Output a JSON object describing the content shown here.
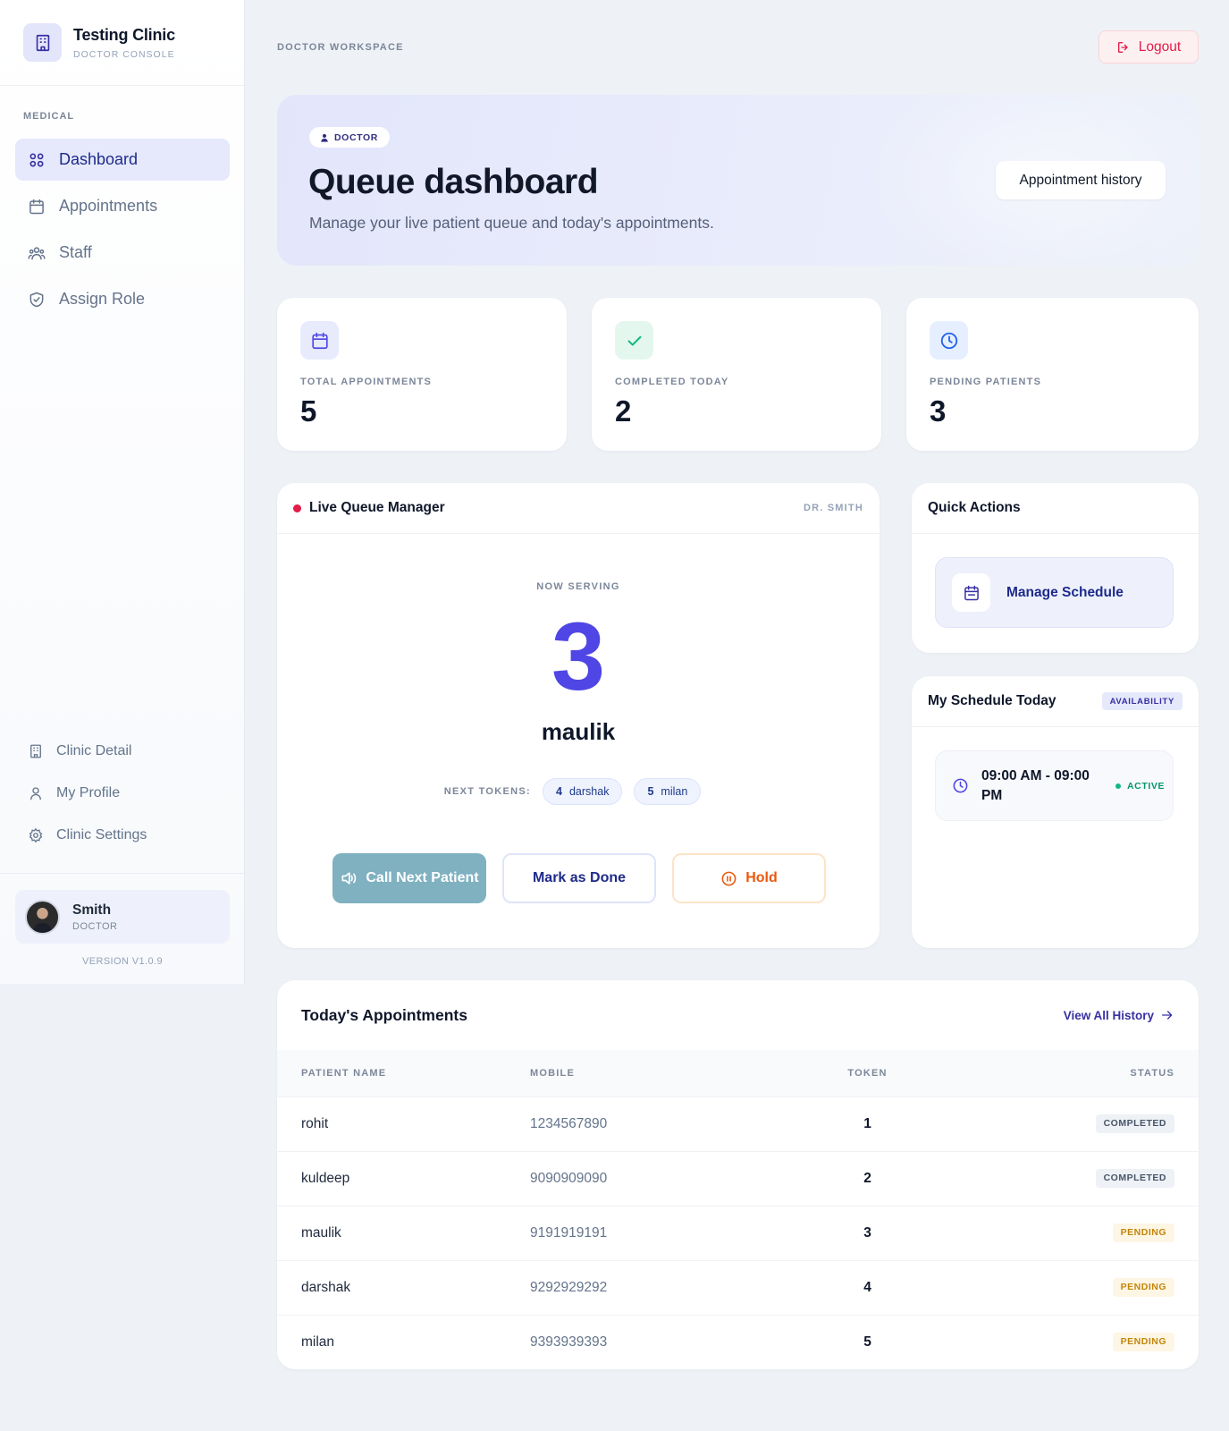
{
  "brand": {
    "name": "Testing Clinic",
    "subtitle": "DOCTOR CONSOLE"
  },
  "sidebar": {
    "section": "MEDICAL",
    "items": [
      {
        "label": "Dashboard",
        "icon": "grid-icon",
        "active": true
      },
      {
        "label": "Appointments",
        "icon": "calendar-icon"
      },
      {
        "label": "Staff",
        "icon": "users-icon"
      },
      {
        "label": "Assign Role",
        "icon": "shield-check-icon"
      }
    ],
    "bottom_items": [
      {
        "label": "Clinic Detail",
        "icon": "building-icon"
      },
      {
        "label": "My Profile",
        "icon": "user-icon"
      },
      {
        "label": "Clinic Settings",
        "icon": "gear-icon"
      }
    ],
    "user": {
      "name": "Smith",
      "role": "DOCTOR"
    },
    "version": "VERSION V1.0.9"
  },
  "topbar": {
    "label": "DOCTOR WORKSPACE",
    "logout": "Logout"
  },
  "hero": {
    "chip": "DOCTOR",
    "title": "Queue dashboard",
    "subtitle": "Manage your live patient queue and today's appointments.",
    "button": "Appointment history"
  },
  "stats": [
    {
      "label": "TOTAL APPOINTMENTS",
      "value": "5",
      "icon": "calendar-icon",
      "color": "#4f46e5"
    },
    {
      "label": "COMPLETED TODAY",
      "value": "2",
      "icon": "check-icon",
      "color": "#10b981"
    },
    {
      "label": "PENDING PATIENTS",
      "value": "3",
      "icon": "clock-icon",
      "color": "#2563eb"
    }
  ],
  "queue": {
    "title": "Live Queue Manager",
    "doctor": "DR. SMITH",
    "now_serving_label": "NOW SERVING",
    "token": "3",
    "patient": "maulik",
    "next_label": "NEXT TOKENS:",
    "next_tokens": [
      {
        "token": "4",
        "name": "darshak"
      },
      {
        "token": "5",
        "name": "milan"
      }
    ],
    "buttons": {
      "call": "Call Next Patient",
      "done": "Mark as Done",
      "hold": "Hold"
    }
  },
  "quick_actions": {
    "title": "Quick Actions",
    "manage": "Manage Schedule"
  },
  "schedule": {
    "title": "My Schedule Today",
    "badge": "AVAILABILITY",
    "time": "09:00 AM - 09:00 PM",
    "status": "ACTIVE"
  },
  "appointments": {
    "title": "Today's Appointments",
    "view_all": "View All History",
    "columns": [
      "PATIENT NAME",
      "MOBILE",
      "TOKEN",
      "STATUS"
    ],
    "rows": [
      {
        "name": "rohit",
        "mobile": "1234567890",
        "token": "1",
        "status": "COMPLETED"
      },
      {
        "name": "kuldeep",
        "mobile": "9090909090",
        "token": "2",
        "status": "COMPLETED"
      },
      {
        "name": "maulik",
        "mobile": "9191919191",
        "token": "3",
        "status": "PENDING"
      },
      {
        "name": "darshak",
        "mobile": "9292929292",
        "token": "4",
        "status": "PENDING"
      },
      {
        "name": "milan",
        "mobile": "9393939393",
        "token": "5",
        "status": "PENDING"
      }
    ]
  }
}
